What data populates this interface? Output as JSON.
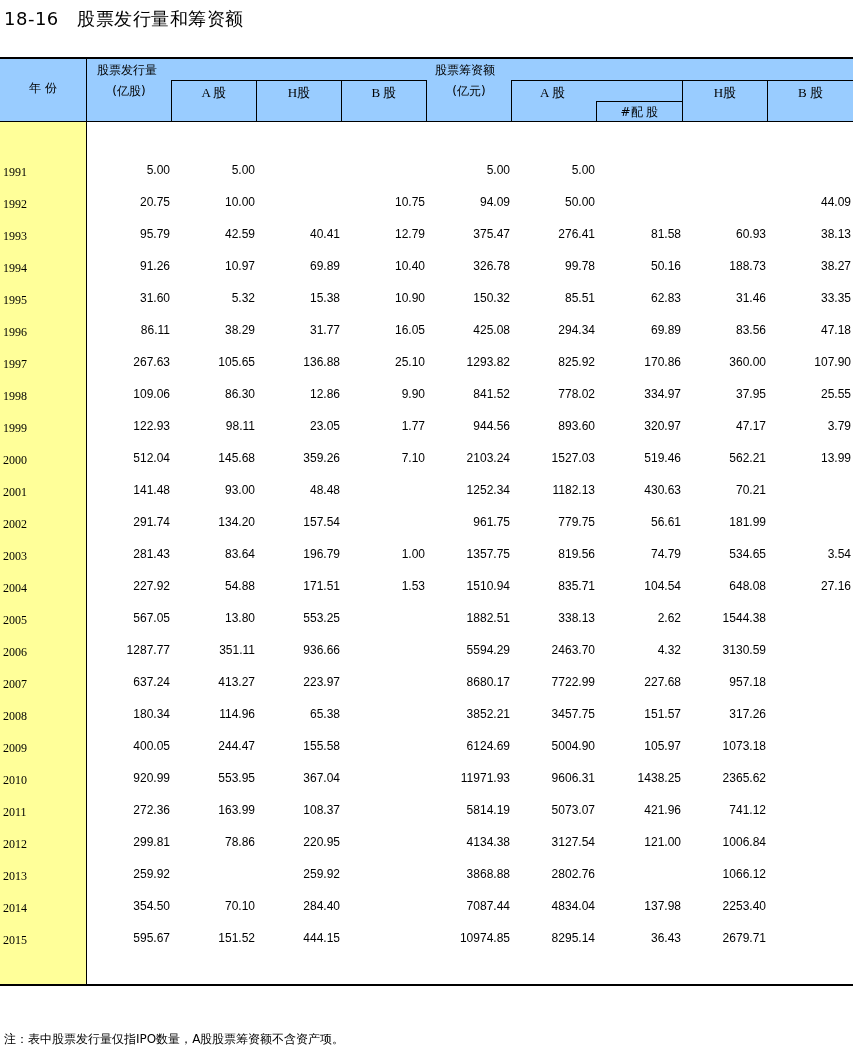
{
  "title": "18-16　股票发行量和筹资额",
  "table": {
    "year_header": "年 份",
    "issuance": {
      "title": "股票发行量",
      "unit": "(亿股)",
      "columns": [
        "A 股",
        "H股",
        "B 股"
      ]
    },
    "funds": {
      "title": "股票筹资额",
      "unit": "(亿元)",
      "a_share": "A 股",
      "a_sub": "#配 股",
      "columns": [
        "H股",
        "B 股"
      ]
    },
    "rows": [
      {
        "year": "1991",
        "issue_total": "5.00",
        "issue_a": "5.00",
        "funds_total": "5.00",
        "funds_a": "5.00"
      },
      {
        "year": "1992",
        "issue_total": "20.75",
        "issue_a": "10.00",
        "issue_b": "10.75",
        "funds_total": "94.09",
        "funds_a": "50.00",
        "funds_b": "44.09"
      },
      {
        "year": "1993",
        "issue_total": "95.79",
        "issue_a": "42.59",
        "issue_h": "40.41",
        "issue_b": "12.79",
        "funds_total": "375.47",
        "funds_a": "276.41",
        "funds_a_rights": "81.58",
        "funds_h": "60.93",
        "funds_b": "38.13"
      },
      {
        "year": "1994",
        "issue_total": "91.26",
        "issue_a": "10.97",
        "issue_h": "69.89",
        "issue_b": "10.40",
        "funds_total": "326.78",
        "funds_a": "99.78",
        "funds_a_rights": "50.16",
        "funds_h": "188.73",
        "funds_b": "38.27"
      },
      {
        "year": "1995",
        "issue_total": "31.60",
        "issue_a": "5.32",
        "issue_h": "15.38",
        "issue_b": "10.90",
        "funds_total": "150.32",
        "funds_a": "85.51",
        "funds_a_rights": "62.83",
        "funds_h": "31.46",
        "funds_b": "33.35"
      },
      {
        "year": "1996",
        "issue_total": "86.11",
        "issue_a": "38.29",
        "issue_h": "31.77",
        "issue_b": "16.05",
        "funds_total": "425.08",
        "funds_a": "294.34",
        "funds_a_rights": "69.89",
        "funds_h": "83.56",
        "funds_b": "47.18"
      },
      {
        "year": "1997",
        "issue_total": "267.63",
        "issue_a": "105.65",
        "issue_h": "136.88",
        "issue_b": "25.10",
        "funds_total": "1293.82",
        "funds_a": "825.92",
        "funds_a_rights": "170.86",
        "funds_h": "360.00",
        "funds_b": "107.90"
      },
      {
        "year": "1998",
        "issue_total": "109.06",
        "issue_a": "86.30",
        "issue_h": "12.86",
        "issue_b": "9.90",
        "funds_total": "841.52",
        "funds_a": "778.02",
        "funds_a_rights": "334.97",
        "funds_h": "37.95",
        "funds_b": "25.55"
      },
      {
        "year": "1999",
        "issue_total": "122.93",
        "issue_a": "98.11",
        "issue_h": "23.05",
        "issue_b": "1.77",
        "funds_total": "944.56",
        "funds_a": "893.60",
        "funds_a_rights": "320.97",
        "funds_h": "47.17",
        "funds_b": "3.79"
      },
      {
        "year": "2000",
        "issue_total": "512.04",
        "issue_a": "145.68",
        "issue_h": "359.26",
        "issue_b": "7.10",
        "funds_total": "2103.24",
        "funds_a": "1527.03",
        "funds_a_rights": "519.46",
        "funds_h": "562.21",
        "funds_b": "13.99"
      },
      {
        "year": "2001",
        "issue_total": "141.48",
        "issue_a": "93.00",
        "issue_h": "48.48",
        "funds_total": "1252.34",
        "funds_a": "1182.13",
        "funds_a_rights": "430.63",
        "funds_h": "70.21"
      },
      {
        "year": "2002",
        "issue_total": "291.74",
        "issue_a": "134.20",
        "issue_h": "157.54",
        "funds_total": "961.75",
        "funds_a": "779.75",
        "funds_a_rights": "56.61",
        "funds_h": "181.99"
      },
      {
        "year": "2003",
        "issue_total": "281.43",
        "issue_a": "83.64",
        "issue_h": "196.79",
        "issue_b": "1.00",
        "funds_total": "1357.75",
        "funds_a": "819.56",
        "funds_a_rights": "74.79",
        "funds_h": "534.65",
        "funds_b": "3.54"
      },
      {
        "year": "2004",
        "issue_total": "227.92",
        "issue_a": "54.88",
        "issue_h": "171.51",
        "issue_b": "1.53",
        "funds_total": "1510.94",
        "funds_a": "835.71",
        "funds_a_rights": "104.54",
        "funds_h": "648.08",
        "funds_b": "27.16"
      },
      {
        "year": "2005",
        "issue_total": "567.05",
        "issue_a": "13.80",
        "issue_h": "553.25",
        "funds_total": "1882.51",
        "funds_a": "338.13",
        "funds_a_rights": "2.62",
        "funds_h": "1544.38"
      },
      {
        "year": "2006",
        "issue_total": "1287.77",
        "issue_a": "351.11",
        "issue_h": "936.66",
        "funds_total": "5594.29",
        "funds_a": "2463.70",
        "funds_a_rights": "4.32",
        "funds_h": "3130.59"
      },
      {
        "year": "2007",
        "issue_total": "637.24",
        "issue_a": "413.27",
        "issue_h": "223.97",
        "funds_total": "8680.17",
        "funds_a": "7722.99",
        "funds_a_rights": "227.68",
        "funds_h": "957.18"
      },
      {
        "year": "2008",
        "issue_total": "180.34",
        "issue_a": "114.96",
        "issue_h": "65.38",
        "funds_total": "3852.21",
        "funds_a": "3457.75",
        "funds_a_rights": "151.57",
        "funds_h": "317.26"
      },
      {
        "year": "2009",
        "issue_total": "400.05",
        "issue_a": "244.47",
        "issue_h": "155.58",
        "funds_total": "6124.69",
        "funds_a": "5004.90",
        "funds_a_rights": "105.97",
        "funds_h": "1073.18"
      },
      {
        "year": "2010",
        "issue_total": "920.99",
        "issue_a": "553.95",
        "issue_h": "367.04",
        "funds_total": "11971.93",
        "funds_a": "9606.31",
        "funds_a_rights": "1438.25",
        "funds_h": "2365.62"
      },
      {
        "year": "2011",
        "issue_total": "272.36",
        "issue_a": "163.99",
        "issue_h": "108.37",
        "funds_total": "5814.19",
        "funds_a": "5073.07",
        "funds_a_rights": "421.96",
        "funds_h": "741.12"
      },
      {
        "year": "2012",
        "issue_total": "299.81",
        "issue_a": "78.86",
        "issue_h": "220.95",
        "funds_total": "4134.38",
        "funds_a": "3127.54",
        "funds_a_rights": "121.00",
        "funds_h": "1006.84"
      },
      {
        "year": "2013",
        "issue_total": "259.92",
        "issue_h": "259.92",
        "funds_total": "3868.88",
        "funds_a": "2802.76",
        "funds_h": "1066.12"
      },
      {
        "year": "2014",
        "issue_total": "354.50",
        "issue_a": "70.10",
        "issue_h": "284.40",
        "funds_total": "7087.44",
        "funds_a": "4834.04",
        "funds_a_rights": "137.98",
        "funds_h": "2253.40"
      },
      {
        "year": "2015",
        "issue_total": "595.67",
        "issue_a": "151.52",
        "issue_h": "444.15",
        "funds_total": "10974.85",
        "funds_a": "8295.14",
        "funds_a_rights": "36.43",
        "funds_h": "2679.71"
      }
    ]
  },
  "note": "注：表中股票发行量仅指IPO数量，A股股票筹资额不含资产项。"
}
